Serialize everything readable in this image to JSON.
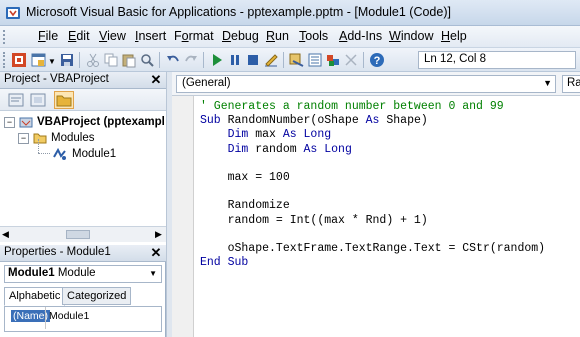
{
  "window": {
    "title": "Microsoft Visual Basic for Applications - pptexample.pptm - [Module1 (Code)]",
    "icon": "vba-app-icon"
  },
  "menu": [
    {
      "label": "File",
      "key": "F"
    },
    {
      "label": "Edit",
      "key": "E"
    },
    {
      "label": "View",
      "key": "V"
    },
    {
      "label": "Insert",
      "key": "I"
    },
    {
      "label": "Format",
      "key": "o"
    },
    {
      "label": "Debug",
      "key": "D"
    },
    {
      "label": "Run",
      "key": "R"
    },
    {
      "label": "Tools",
      "key": "T"
    },
    {
      "label": "Add-Ins",
      "key": "A"
    },
    {
      "label": "Window",
      "key": "W"
    },
    {
      "label": "Help",
      "key": "H"
    }
  ],
  "toolbar": {
    "cursor_position": "Ln 12, Col 8"
  },
  "project_pane": {
    "title": "Project - VBAProject",
    "tree": [
      {
        "label": "VBAProject (pptexampl",
        "level": 0,
        "icon": "vba-project-icon"
      },
      {
        "label": "Modules",
        "level": 1,
        "icon": "folder-icon"
      },
      {
        "label": "Module1",
        "level": 2,
        "icon": "module-icon"
      }
    ]
  },
  "properties_pane": {
    "title": "Properties - Module1",
    "object_name": "Module1",
    "object_type": "Module",
    "tabs": [
      "Alphabetic",
      "Categorized"
    ],
    "active_tab": "Alphabetic",
    "rows": [
      {
        "name": "(Name)",
        "value": "Module1"
      }
    ]
  },
  "code_window": {
    "object_combo": "(General)",
    "procedure_combo": "Ran",
    "lines": [
      [
        {
          "t": "' Generates a random number between 0 and 99",
          "c": "cm"
        }
      ],
      [
        {
          "t": "Sub ",
          "c": "kw"
        },
        {
          "t": "RandomNumber(oShape ",
          "c": "tx"
        },
        {
          "t": "As ",
          "c": "kw"
        },
        {
          "t": "Shape)",
          "c": "tx"
        }
      ],
      [
        {
          "t": "    Dim ",
          "c": "kw"
        },
        {
          "t": "max ",
          "c": "tx"
        },
        {
          "t": "As Long",
          "c": "kw"
        }
      ],
      [
        {
          "t": "    Dim ",
          "c": "kw"
        },
        {
          "t": "random ",
          "c": "tx"
        },
        {
          "t": "As Long",
          "c": "kw"
        }
      ],
      [
        {
          "t": "",
          "c": "tx"
        }
      ],
      [
        {
          "t": "    max = 100",
          "c": "tx"
        }
      ],
      [
        {
          "t": "",
          "c": "tx"
        }
      ],
      [
        {
          "t": "    Randomize",
          "c": "tx"
        }
      ],
      [
        {
          "t": "    random = Int((max * Rnd) + 1)",
          "c": "tx"
        }
      ],
      [
        {
          "t": "",
          "c": "tx"
        }
      ],
      [
        {
          "t": "    oShape.TextFrame.TextRange.Text = CStr(random)",
          "c": "tx"
        }
      ],
      [
        {
          "t": "End Sub",
          "c": "kw"
        }
      ]
    ]
  },
  "colors": {
    "keyword": "#0000a0",
    "comment": "#008000",
    "selection": "#3a6fb8"
  }
}
